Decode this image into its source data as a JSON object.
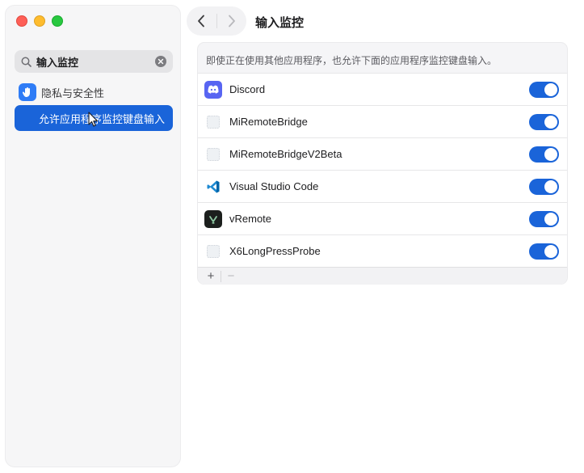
{
  "window": {
    "title": "输入监控"
  },
  "sidebar": {
    "search": {
      "value": "输入监控",
      "icon": "search-icon"
    },
    "parent_item": {
      "label": "隐私与安全性",
      "icon": "hand-icon",
      "icon_color": "#2f7cf6"
    },
    "active_item": {
      "label": "允许应用程序监控键盘输入"
    }
  },
  "toolbar": {
    "back_icon": "chevron-left-icon",
    "forward_icon": "chevron-right-icon"
  },
  "content": {
    "description": "即使正在使用其他应用程序，也允许下面的应用程序监控键盘输入。",
    "apps": [
      {
        "name": "Discord",
        "icon": "discord-icon",
        "enabled": true
      },
      {
        "name": "MiRemoteBridge",
        "icon": "generic-app-icon",
        "enabled": true
      },
      {
        "name": "MiRemoteBridgeV2Beta",
        "icon": "generic-app-icon",
        "enabled": true
      },
      {
        "name": "Visual Studio Code",
        "icon": "vscode-icon",
        "enabled": true
      },
      {
        "name": "vRemote",
        "icon": "vremote-icon",
        "enabled": true
      },
      {
        "name": "X6LongPressProbe",
        "icon": "generic-app-icon",
        "enabled": true
      }
    ],
    "footer": {
      "add_label": "+",
      "remove_label": "−"
    }
  },
  "colors": {
    "accent": "#1a64d9",
    "close": "#fe5f57",
    "minimize": "#febc2e",
    "zoom": "#28c840"
  }
}
